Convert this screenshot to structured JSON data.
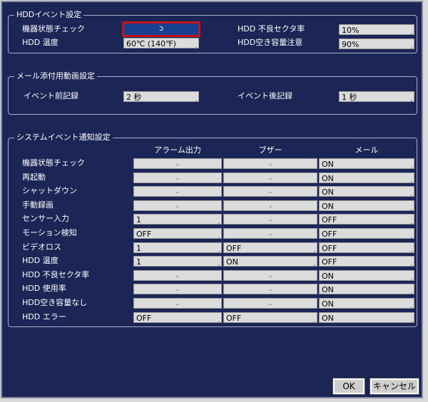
{
  "hdd_event": {
    "legend": "HDDイベント設定",
    "device_status_label": "機器状態チェック",
    "device_status_value": "ↄ",
    "temp_label": "HDD 温度",
    "temp_value": "60℃ (140℉)",
    "bad_sector_label": "HDD 不良セクタ率",
    "bad_sector_value": "10%",
    "free_space_label": "HDD空き容量注意",
    "free_space_value": "90%"
  },
  "mail_video": {
    "legend": "メール添付用動画設定",
    "pre_label": "イベント前記録",
    "pre_value": "2 秒",
    "post_label": "イベント後記録",
    "post_value": "1 秒"
  },
  "system_event": {
    "legend": "システムイベント通知設定",
    "col_alarm": "アラーム出力",
    "col_buzzer": "ブザー",
    "col_mail": "メール",
    "rows": [
      {
        "label": "機器状態チェック",
        "alarm": "-",
        "buzzer": "-",
        "mail": "ON"
      },
      {
        "label": "再起動",
        "alarm": "-",
        "buzzer": "-",
        "mail": "ON"
      },
      {
        "label": "シャットダウン",
        "alarm": "-",
        "buzzer": "-",
        "mail": "ON"
      },
      {
        "label": "手動録画",
        "alarm": "-",
        "buzzer": "-",
        "mail": "ON"
      },
      {
        "label": "センサー入力",
        "alarm": "1",
        "buzzer": "-",
        "mail": "OFF"
      },
      {
        "label": "モーション検知",
        "alarm": "OFF",
        "buzzer": "-",
        "mail": "OFF"
      },
      {
        "label": "ビデオロス",
        "alarm": "1",
        "buzzer": "OFF",
        "mail": "OFF"
      },
      {
        "label": "HDD 温度",
        "alarm": "1",
        "buzzer": "ON",
        "mail": "OFF"
      },
      {
        "label": "HDD 不良セクタ率",
        "alarm": "-",
        "buzzer": "-",
        "mail": "ON"
      },
      {
        "label": "HDD 使用率",
        "alarm": "-",
        "buzzer": "-",
        "mail": "ON"
      },
      {
        "label": "HDD空き容量なし",
        "alarm": "-",
        "buzzer": "-",
        "mail": "ON"
      },
      {
        "label": "HDD エラー",
        "alarm": "OFF",
        "buzzer": "OFF",
        "mail": "ON"
      }
    ]
  },
  "buttons": {
    "ok": "OK",
    "cancel": "キャンセル"
  }
}
